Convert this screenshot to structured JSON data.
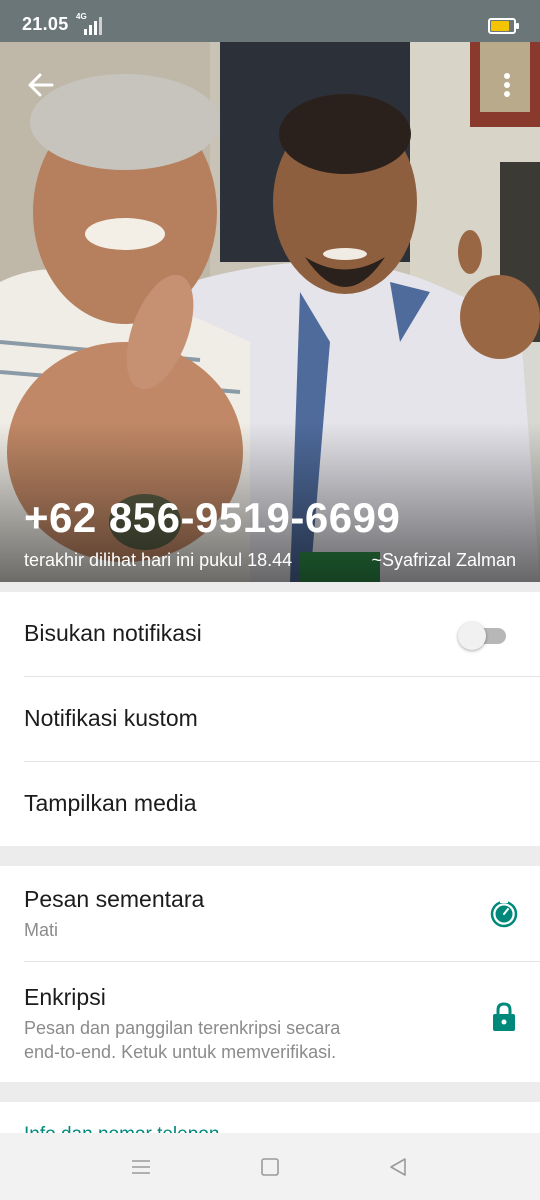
{
  "status_bar": {
    "time": "21.05",
    "network": "4G",
    "battery_color": "#f5c400",
    "battery_level": 0.8
  },
  "header": {
    "back_icon": "arrow-back-icon",
    "menu_icon": "more-vert-icon"
  },
  "profile": {
    "phone_number": "+62 856-9519-6699",
    "last_seen": "terakhir dilihat hari ini pukul 18.44",
    "push_name": "~Syafrizal Zalman"
  },
  "settings": {
    "mute": {
      "label": "Bisukan notifikasi",
      "enabled": false
    },
    "custom_notifications": {
      "label": "Notifikasi kustom"
    },
    "media_visibility": {
      "label": "Tampilkan media"
    },
    "disappearing": {
      "label": "Pesan sementara",
      "value": "Mati",
      "icon": "timer-icon"
    },
    "encryption": {
      "label": "Enkripsi",
      "sub_line1": "Pesan dan panggilan terenkripsi secara",
      "sub_line2": "end-to-end. Ketuk untuk memverifikasi.",
      "icon": "lock-icon"
    },
    "about_section": {
      "label": "Info dan nomor telepon"
    }
  },
  "colors": {
    "accent": "#00897b",
    "status_bar": "#6b7678"
  },
  "nav_bar": {
    "menu_icon": "recents-menu-icon",
    "home_icon": "home-square-icon",
    "back_icon": "back-triangle-icon"
  }
}
